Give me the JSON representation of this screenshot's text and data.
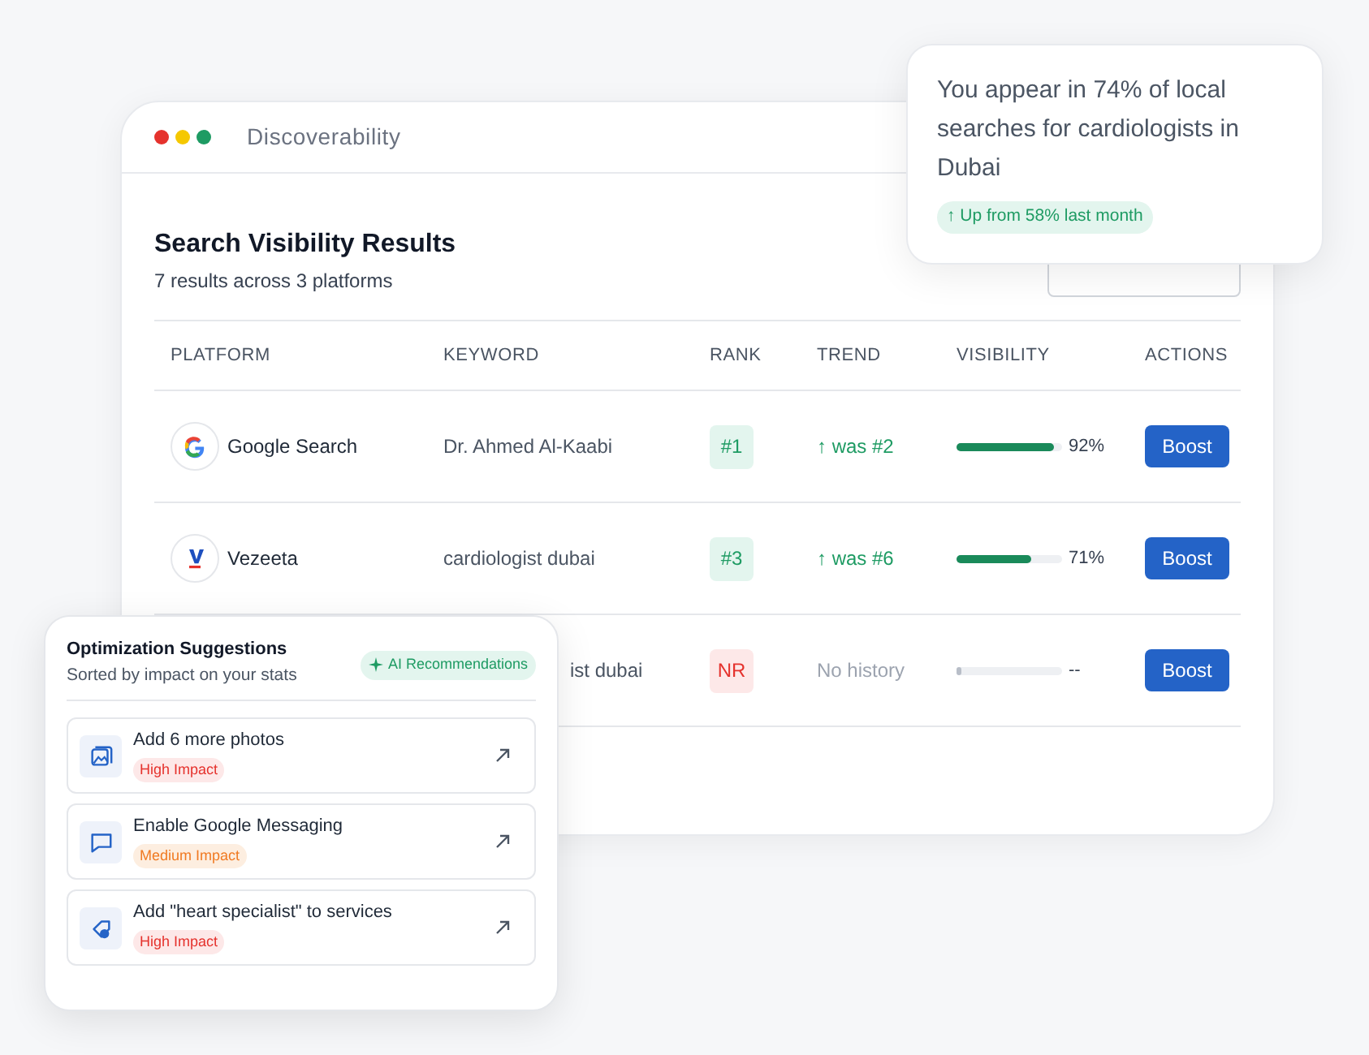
{
  "window": {
    "title": "Discoverability"
  },
  "results": {
    "title": "Search Visibility Results",
    "subtitle": "7 results across 3 platforms",
    "columns": [
      "PLATFORM",
      "KEYWORD",
      "RANK",
      "TREND",
      "VISIBILITY",
      "ACTIONS"
    ],
    "rows": [
      {
        "platform": {
          "name": "Google Search",
          "kind": "google"
        },
        "keyword": "Dr. Ahmed Al-Kaabi",
        "rank": {
          "label": "#1",
          "kind": "ranked"
        },
        "trend": {
          "label": "↑ was #2",
          "kind": "up"
        },
        "level": 0.92,
        "reading": "92%",
        "action": "Boost"
      },
      {
        "platform": {
          "name": "Vezeeta",
          "kind": "vezeeta"
        },
        "keyword": "cardiologist dubai",
        "rank": {
          "label": "#3",
          "kind": "ranked"
        },
        "trend": {
          "label": "↑ was #6",
          "kind": "up"
        },
        "level": 0.71,
        "reading": "71%",
        "action": "Boost"
      },
      {
        "keyword": "ist dubai",
        "rank": {
          "label": "NR",
          "kind": "unranked"
        },
        "trend": {
          "label": "No history",
          "kind": "none"
        },
        "level": 0.05,
        "reading": "--",
        "action": "Boost"
      }
    ]
  },
  "insight": {
    "text": "You appear in 74% of local searches for cardiologists in Dubai",
    "badge": "↑ Up from 58% last month"
  },
  "suggestions": {
    "title": "Optimization Suggestions",
    "subtitle": "Sorted by impact on your stats",
    "badge": "AI Recommendations",
    "items": [
      {
        "title": "Add 6 more photos",
        "impact": "High Impact",
        "kind": "high"
      },
      {
        "title": "Enable Google Messaging",
        "impact": "Medium Impact",
        "kind": "medium"
      },
      {
        "title": "Add \"heart specialist\" to services",
        "impact": "High Impact",
        "kind": "high"
      }
    ]
  }
}
